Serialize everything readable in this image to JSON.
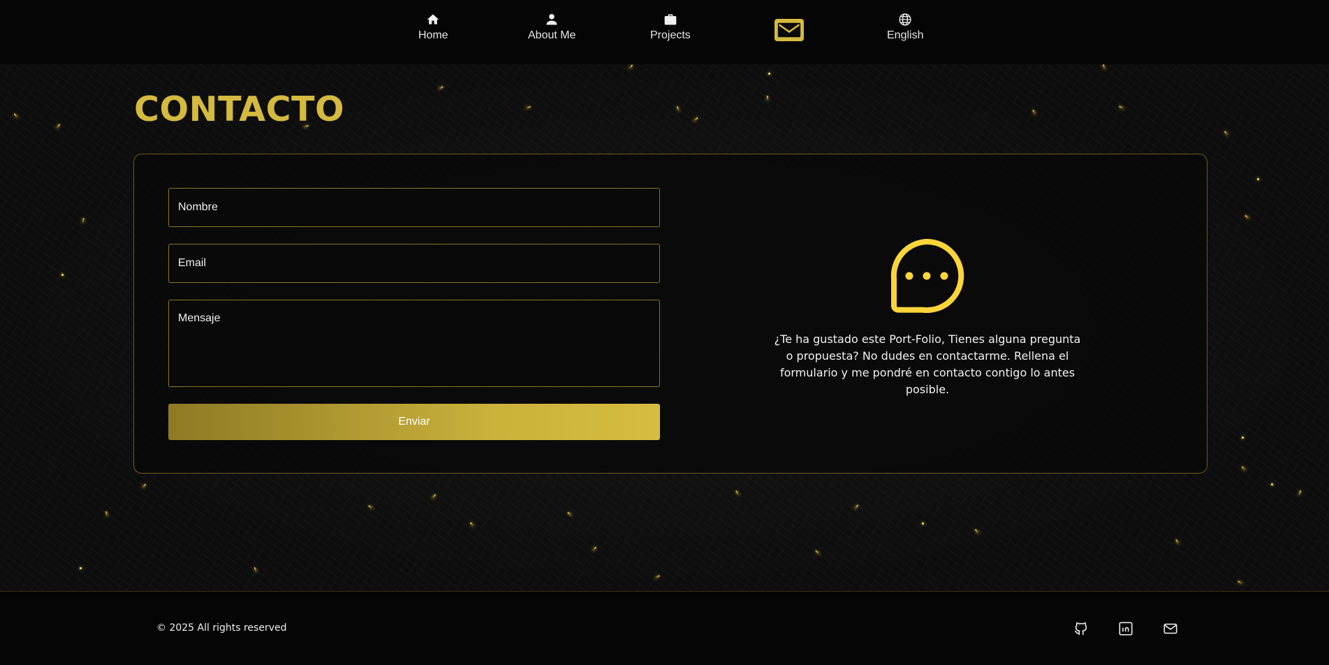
{
  "nav": {
    "items": [
      {
        "label": "Home",
        "icon": "home-icon"
      },
      {
        "label": "About Me",
        "icon": "user-icon"
      },
      {
        "label": "Projects",
        "icon": "briefcase-icon"
      },
      {
        "label": "",
        "icon": "mail-icon"
      },
      {
        "label": "English",
        "icon": "globe-icon"
      }
    ]
  },
  "page": {
    "title": "CONTACTO"
  },
  "form": {
    "name_placeholder": "Nombre",
    "email_placeholder": "Email",
    "message_placeholder": "Mensaje",
    "submit_label": "Enviar"
  },
  "info": {
    "icon": "chat-bubble-icon",
    "text": "¿Te ha gustado este Port-Folio, Tienes alguna pregunta o propuesta? No dudes en contactarme. Rellena el formulario y me pondré en contacto contigo lo antes posible."
  },
  "footer": {
    "copyright": "© 2025 All rights reserved",
    "social": [
      "github-icon",
      "linkedin-icon",
      "mail-icon"
    ]
  },
  "colors": {
    "accent": "#d4ba3e",
    "background": "#0b0b0b",
    "nav_background": "#050505",
    "border": "#8a7526"
  }
}
